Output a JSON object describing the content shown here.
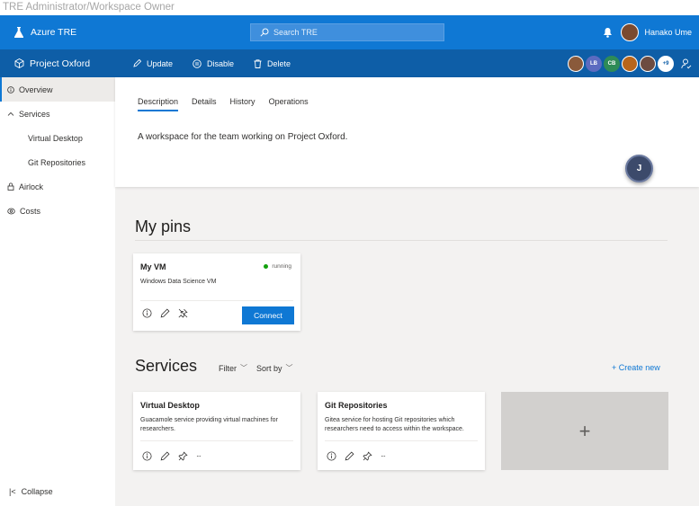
{
  "caption": "TRE Administrator/Workspace Owner",
  "topbar": {
    "app_title": "Azure TRE",
    "search_placeholder": "Search TRE",
    "user_name": "Hanako Ume",
    "brand_color": "#0f78d4"
  },
  "workspace_bar": {
    "title": "Project Oxford",
    "commands": [
      "Update",
      "Disable",
      "Delete"
    ],
    "participants": [
      {
        "initials": "",
        "color": "#8a5a3b"
      },
      {
        "initials": "LB",
        "color": "#5c6bc0"
      },
      {
        "initials": "CB",
        "color": "#2e8b57"
      },
      {
        "initials": "",
        "color": "#b8651b"
      },
      {
        "initials": "",
        "color": "#6d4c41"
      },
      {
        "initials": "+9",
        "color": "#ffffff"
      }
    ],
    "bar_color": "#0e5ea7"
  },
  "sidebar": {
    "items": [
      {
        "label": "Overview",
        "icon": "info-icon"
      },
      {
        "label": "Services",
        "icon": "chevron-up-icon"
      },
      {
        "label": "Virtual Desktop"
      },
      {
        "label": "Git Repositories"
      },
      {
        "label": "Airlock",
        "icon": "lock-icon"
      },
      {
        "label": "Costs",
        "icon": "money-icon"
      }
    ],
    "collapse_label": "Collapse"
  },
  "overview": {
    "tabs": [
      "Description",
      "Details",
      "History",
      "Operations"
    ],
    "description": "A workspace for the team working on Project Oxford.",
    "bubble_initial": "J"
  },
  "pins": {
    "title": "My pins",
    "card": {
      "title": "My VM",
      "status": "running",
      "description": "Windows Data Science VM",
      "connect_label": "Connect"
    }
  },
  "services": {
    "title": "Services",
    "filter_label": "Filter",
    "sort_label": "Sort by",
    "create_label": "+ Create new",
    "cards": [
      {
        "title": "Virtual Desktop",
        "description": "Guacamole service providing virtual machines for researchers."
      },
      {
        "title": "Git Repositories",
        "description": "Gitea service for hosting Git repositories which researchers need to access within the workspace."
      }
    ],
    "add_symbol": "+",
    "more_symbol": "···"
  }
}
